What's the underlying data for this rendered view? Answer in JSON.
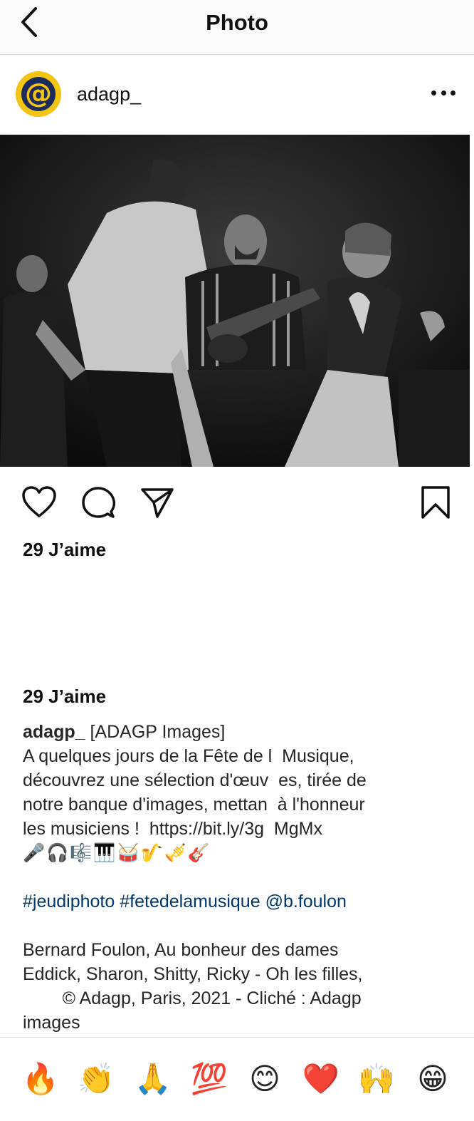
{
  "topbar": {
    "title": "Photo"
  },
  "post": {
    "username": "adagp_",
    "avatar_letter": "@",
    "likes_text": "29 J’aime"
  },
  "caption": {
    "username": "adagp_",
    "first_line_rest": " [ADAGP Images]",
    "lines": [
      "A quelques jours de la Fête de l  Musique,",
      "découvrez une sélection d'œuv  es, tirée de",
      "notre banque d'images, mettan  à l'honneur",
      "les musiciens !  https://bit.ly/3g  MgMx"
    ],
    "emojis": "🎤🎧🎼🎹🥁🎷🎺🎸",
    "hashtags": [
      "#jeudiphoto",
      "#fetedelamusique",
      "@b.foulon"
    ],
    "credit_lines": [
      "Bernard Foulon, Au bonheur des dames",
      "Eddick, Sharon, Shitty, Ricky - Oh les filles,",
      "        © Adagp, Paris, 2021 - Cliché : Adagp",
      "images"
    ]
  },
  "reactions": [
    "🔥",
    "👏",
    "🙏",
    "💯",
    "😊",
    "❤️",
    "🙌",
    "😁"
  ],
  "colors": {
    "hashtag": "#00376b",
    "avatar_ring": "#f2c413",
    "avatar_inner": "#1a2b5c"
  }
}
